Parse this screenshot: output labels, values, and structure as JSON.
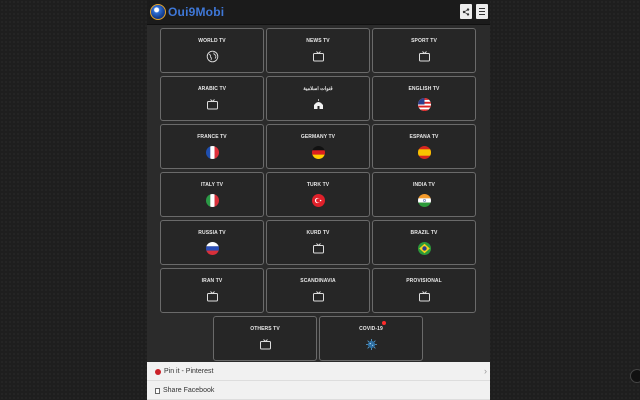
{
  "header": {
    "app_name": "Oui9Mobi"
  },
  "tiles": {
    "world": "WORLD TV",
    "news": "NEWS TV",
    "sport": "SPORT TV",
    "arabic": "ARABIC TV",
    "islamic": "قنوات اسلامية",
    "english": "ENGLISH TV",
    "france": "FRANCE TV",
    "germany": "GERMANY TV",
    "espana": "ESPANA TV",
    "italy": "ITALY TV",
    "turk": "TURK TV",
    "india": "INDIA TV",
    "russia": "RUSSIA TV",
    "kurd": "KURD TV",
    "brazil": "BRAZIL TV",
    "iran": "IRAN TV",
    "scandinavia": "SCANDINAVIA",
    "provisional": "PROVISIONAL",
    "others": "OTHERS TV",
    "covid": "COVID-19"
  },
  "icons": {
    "world": "globe-icon",
    "tv": "tv-icon",
    "islamic": "mosque-icon",
    "covid": "virus-icon"
  },
  "footer": {
    "pin": "Pin it - Pinterest",
    "share_fb": "Share Facebook"
  },
  "colors": {
    "brand": "#3f78d8",
    "tile_border": "#6a6a6a",
    "notification": "#ff2b2b"
  }
}
